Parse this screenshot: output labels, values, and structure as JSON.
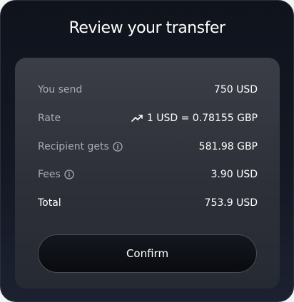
{
  "dialog": {
    "title": "Review your transfer"
  },
  "details": {
    "you_send": {
      "label": "You send",
      "value": "750 USD"
    },
    "rate": {
      "label": "Rate",
      "value": "1 USD = 0.78155 GBP",
      "icon": "trend-up-icon"
    },
    "recipient_gets": {
      "label": "Recipient gets",
      "value": "581.98 GBP",
      "icon": "info-icon"
    },
    "fees": {
      "label": "Fees",
      "value": "3.90 USD",
      "icon": "info-icon"
    },
    "total": {
      "label": "Total",
      "value": "753.9 USD"
    }
  },
  "actions": {
    "confirm_label": "Confirm"
  },
  "colors": {
    "background": "#151925",
    "card": "#2f323a",
    "label": "#a7abb4",
    "text": "#ffffff"
  }
}
